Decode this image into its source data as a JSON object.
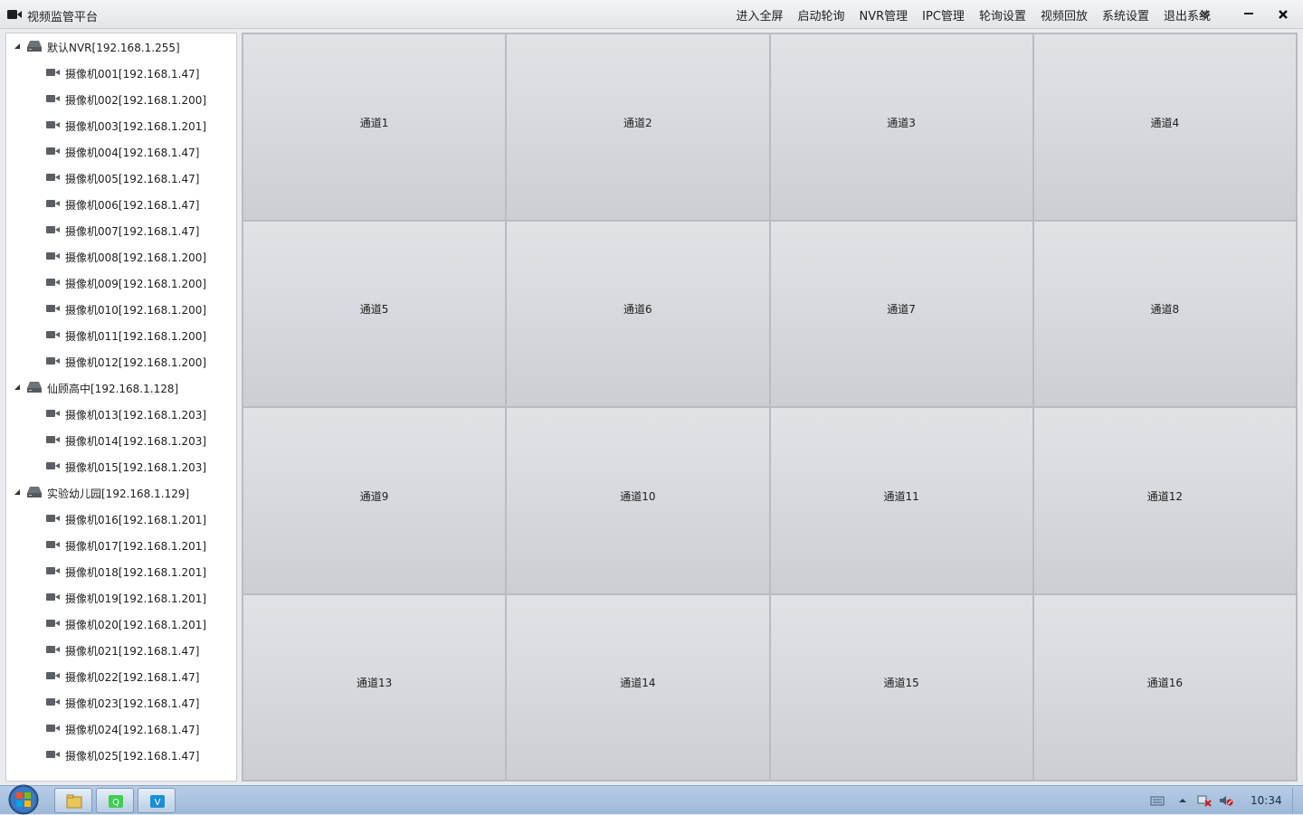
{
  "window": {
    "title": "视频监管平台",
    "app_icon": "video-camera-icon"
  },
  "menu": {
    "items": [
      {
        "label": "进入全屏"
      },
      {
        "label": "启动轮询"
      },
      {
        "label": "NVR管理"
      },
      {
        "label": "IPC管理"
      },
      {
        "label": "轮询设置"
      },
      {
        "label": "视频回放"
      },
      {
        "label": "系统设置"
      },
      {
        "label": "退出系统"
      }
    ],
    "dropdown_icon": "double-chevron-down-icon",
    "minimize_icon": "minimize-icon",
    "close_icon": "close-icon"
  },
  "tree": {
    "rows": [
      {
        "type": "nvr",
        "label": "默认NVR[192.168.1.255]"
      },
      {
        "type": "cam",
        "label": "摄像机001[192.168.1.47]"
      },
      {
        "type": "cam",
        "label": "摄像机002[192.168.1.200]"
      },
      {
        "type": "cam",
        "label": "摄像机003[192.168.1.201]"
      },
      {
        "type": "cam",
        "label": "摄像机004[192.168.1.47]"
      },
      {
        "type": "cam",
        "label": "摄像机005[192.168.1.47]"
      },
      {
        "type": "cam",
        "label": "摄像机006[192.168.1.47]"
      },
      {
        "type": "cam",
        "label": "摄像机007[192.168.1.47]"
      },
      {
        "type": "cam",
        "label": "摄像机008[192.168.1.200]"
      },
      {
        "type": "cam",
        "label": "摄像机009[192.168.1.200]"
      },
      {
        "type": "cam",
        "label": "摄像机010[192.168.1.200]"
      },
      {
        "type": "cam",
        "label": "摄像机011[192.168.1.200]"
      },
      {
        "type": "cam",
        "label": "摄像机012[192.168.1.200]"
      },
      {
        "type": "nvr",
        "label": "仙顾高中[192.168.1.128]"
      },
      {
        "type": "cam",
        "label": "摄像机013[192.168.1.203]"
      },
      {
        "type": "cam",
        "label": "摄像机014[192.168.1.203]"
      },
      {
        "type": "cam",
        "label": "摄像机015[192.168.1.203]"
      },
      {
        "type": "nvr",
        "label": "实验幼儿园[192.168.1.129]"
      },
      {
        "type": "cam",
        "label": "摄像机016[192.168.1.201]"
      },
      {
        "type": "cam",
        "label": "摄像机017[192.168.1.201]"
      },
      {
        "type": "cam",
        "label": "摄像机018[192.168.1.201]"
      },
      {
        "type": "cam",
        "label": "摄像机019[192.168.1.201]"
      },
      {
        "type": "cam",
        "label": "摄像机020[192.168.1.201]"
      },
      {
        "type": "cam",
        "label": "摄像机021[192.168.1.47]"
      },
      {
        "type": "cam",
        "label": "摄像机022[192.168.1.47]"
      },
      {
        "type": "cam",
        "label": "摄像机023[192.168.1.47]"
      },
      {
        "type": "cam",
        "label": "摄像机024[192.168.1.47]"
      },
      {
        "type": "cam",
        "label": "摄像机025[192.168.1.47]"
      }
    ]
  },
  "channels": [
    {
      "label": "通道1"
    },
    {
      "label": "通道2"
    },
    {
      "label": "通道3"
    },
    {
      "label": "通道4"
    },
    {
      "label": "通道5"
    },
    {
      "label": "通道6"
    },
    {
      "label": "通道7"
    },
    {
      "label": "通道8"
    },
    {
      "label": "通道9"
    },
    {
      "label": "通道10"
    },
    {
      "label": "通道11"
    },
    {
      "label": "通道12"
    },
    {
      "label": "通道13"
    },
    {
      "label": "通道14"
    },
    {
      "label": "通道15"
    },
    {
      "label": "通道16"
    }
  ],
  "taskbar": {
    "start_icon": "windows-start-icon",
    "apps": [
      {
        "icon": "file-explorer-icon"
      },
      {
        "icon": "qt-creator-icon"
      },
      {
        "icon": "v-app-icon"
      }
    ],
    "tray_icons": [
      "keyboard-icon",
      "show-hidden-icons-arrow",
      "network-error-icon",
      "volume-muted-icon"
    ],
    "clock": "10:34"
  },
  "colors": {
    "accent_blue": "#9db8d8",
    "cell_top": "#e0e3e6",
    "cell_bottom": "#ccced4"
  }
}
